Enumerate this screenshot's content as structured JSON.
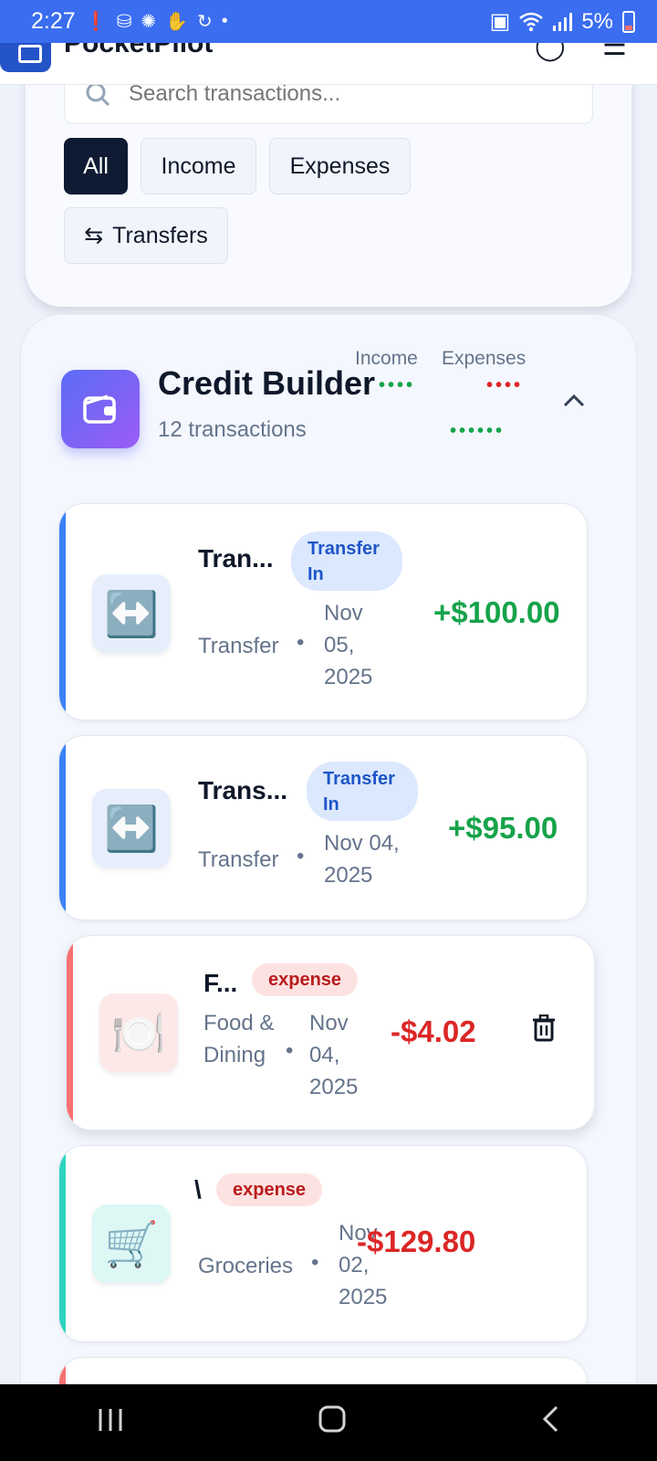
{
  "status_bar": {
    "time": "2:27",
    "battery_percent": "5%",
    "left_icons": [
      "alert-icon",
      "vpn-icon",
      "brightness-icon",
      "hand-icon",
      "sync-icon",
      "dot-icon"
    ],
    "right_icons": [
      "nfc-icon",
      "wifi-icon",
      "signal-icon",
      "battery-icon"
    ]
  },
  "header": {
    "app_title": "PocketPilot"
  },
  "search": {
    "placeholder": "Search transactions..."
  },
  "filters": {
    "all": "All",
    "income": "Income",
    "expenses": "Expenses",
    "transfers": "Transfers",
    "transfer_glyph": "⇆",
    "active": "All"
  },
  "account": {
    "name": "Credit Builder",
    "count": "12 transactions",
    "income_label": "Income",
    "expenses_label": "Expenses",
    "income_masked": "••••",
    "expenses_masked": "••••",
    "balance_masked": "••••••"
  },
  "transactions": [
    {
      "name": "Tran...",
      "badge": "Transfer In",
      "category": "Transfer",
      "date": "Nov 05, 2025",
      "amount": "+$100.00",
      "icon": "↔️",
      "accent": "#3b82f6"
    },
    {
      "name": "Trans...",
      "badge": "Transfer In",
      "category": "Transfer",
      "date": "Nov 04, 2025",
      "amount": "+$95.00",
      "icon": "↔️",
      "accent": "#3b82f6"
    },
    {
      "name": "F...",
      "badge": "expense",
      "category": "Food & Dining",
      "date": "Nov 04, 2025",
      "amount": "-$4.02",
      "icon": "🍽️",
      "accent": "#f87171"
    },
    {
      "name": "\\",
      "badge": "expense",
      "category": "Groceries",
      "date": "Nov 02, 2025",
      "amount": "-$129.80",
      "icon": "🛒",
      "accent": "#2dd4bf"
    }
  ],
  "colors": {
    "primary": "#3a6df0",
    "income": "#16a34a",
    "expense": "#dc2626",
    "active_chip": "#0f1b33"
  }
}
